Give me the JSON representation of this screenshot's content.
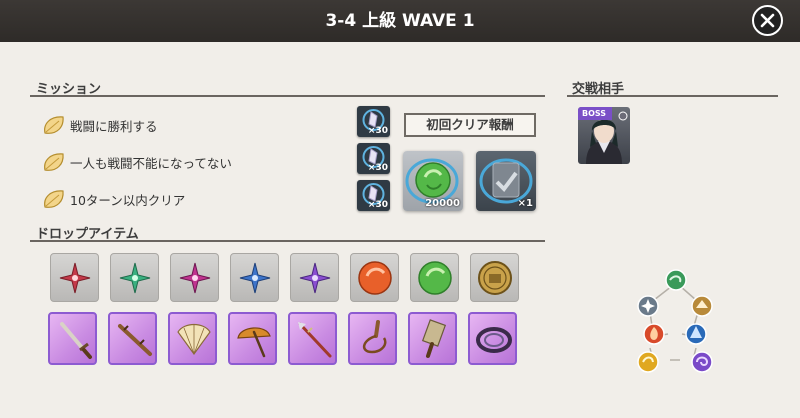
{
  "header": {
    "title": "3-4 上級 WAVE 1"
  },
  "missions_section": {
    "title": "ミッション",
    "items": [
      {
        "label": "戦闘に勝利する",
        "reward_count": "×30"
      },
      {
        "label": "一人も戦闘不能になってない",
        "reward_count": "×30"
      },
      {
        "label": "10ターン以内クリア",
        "reward_count": "×30"
      }
    ],
    "first_clear_label": "初回クリア報酬",
    "first_clear_rewards": [
      {
        "icon": "green-orb-icon",
        "count": "20000"
      },
      {
        "icon": "ticket-icon",
        "count": "×1"
      }
    ]
  },
  "drops_section": {
    "title": "ドロップアイテム",
    "row1": [
      "red-shuriken-icon",
      "green-shuriken-icon",
      "magenta-shuriken-icon",
      "blue-shuriken-icon",
      "purple-shuriken-icon",
      "orange-orb-icon",
      "green-orb-icon",
      "gold-coin-icon"
    ],
    "row2": [
      "sword-icon",
      "staff-icon",
      "fan-icon",
      "umbrella-icon",
      "spear-icon",
      "whip-icon",
      "cleaver-icon",
      "chakram-icon"
    ]
  },
  "opponent_section": {
    "title": "交戦相手",
    "boss_tag": "BOSS"
  },
  "colors": {
    "header": "#2e2b28",
    "accent_purple": "#8d5bd1",
    "background": "#f1eee9"
  }
}
